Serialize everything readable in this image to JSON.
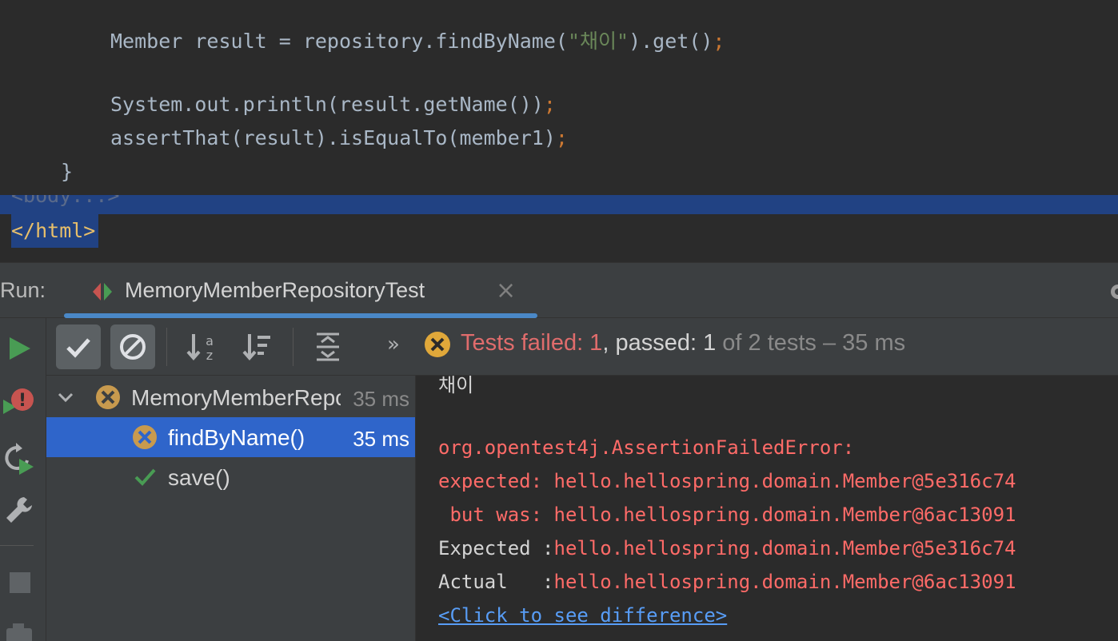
{
  "editor": {
    "line1": {
      "pre": "Member result = repository.findByName(",
      "str": "\"채이\"",
      "post": ").get()",
      "semi": ";"
    },
    "line2": {
      "pre": "System.out.println(result.getName())",
      "semi": ";"
    },
    "line3": {
      "pre": "assertThat(result).isEqualTo(member1)",
      "semi": ";"
    },
    "line4": "}",
    "html_body": "<body...>",
    "html_close": "</html>"
  },
  "run": {
    "label": "Run:",
    "tab_title": "MemoryMemberRepositoryTest",
    "tab_close": "×",
    "overflow": "»"
  },
  "status": {
    "failed": "Tests failed: 1",
    "passed": ", passed: 1",
    "rest": " of 2 tests – 35 ms"
  },
  "tree": {
    "items": [
      {
        "name": "MemoryMemberRepositoryTest",
        "time": "35 ms",
        "state": "failed"
      },
      {
        "name": "findByName()",
        "time": "35 ms",
        "state": "failed"
      },
      {
        "name": "save()",
        "time": "",
        "state": "passed"
      }
    ]
  },
  "console": {
    "lines": [
      {
        "text": "채이",
        "kind": "normal"
      },
      {
        "text": "",
        "kind": "normal"
      },
      {
        "text": "org.opentest4j.AssertionFailedError:",
        "kind": "error"
      },
      {
        "text": "expected: hello.hellospring.domain.Member@5e316c74",
        "kind": "error"
      },
      {
        "text": " but was: hello.hellospring.domain.Member@6ac13091",
        "kind": "error"
      }
    ],
    "expected_label": "Expected :",
    "expected_value": "hello.hellospring.domain.Member@5e316c74",
    "actual_label": "Actual   :",
    "actual_value": "hello.hellospring.domain.Member@6ac13091",
    "link": "<Click to see difference>"
  },
  "colors": {
    "fail": "#e06c6c",
    "pass": "#499c54",
    "accent": "#4a88c7",
    "selection": "#2f65ca",
    "error_text": "#ff6b68",
    "link": "#589df6"
  },
  "icons": {
    "tab": "test-class-icon",
    "run": "play-icon",
    "rerun_failed": "rerun-failed-icon",
    "toggle_auto": "auto-rerun-icon",
    "settings": "wrench-icon",
    "stop": "stop-icon",
    "camera": "camera-icon",
    "show_passed": "checkmark-icon",
    "show_ignored": "ignored-icon",
    "sort_alpha": "sort-alpha-icon",
    "sort_duration": "sort-duration-icon",
    "expand": "expand-all-icon",
    "status": "fail-icon"
  }
}
